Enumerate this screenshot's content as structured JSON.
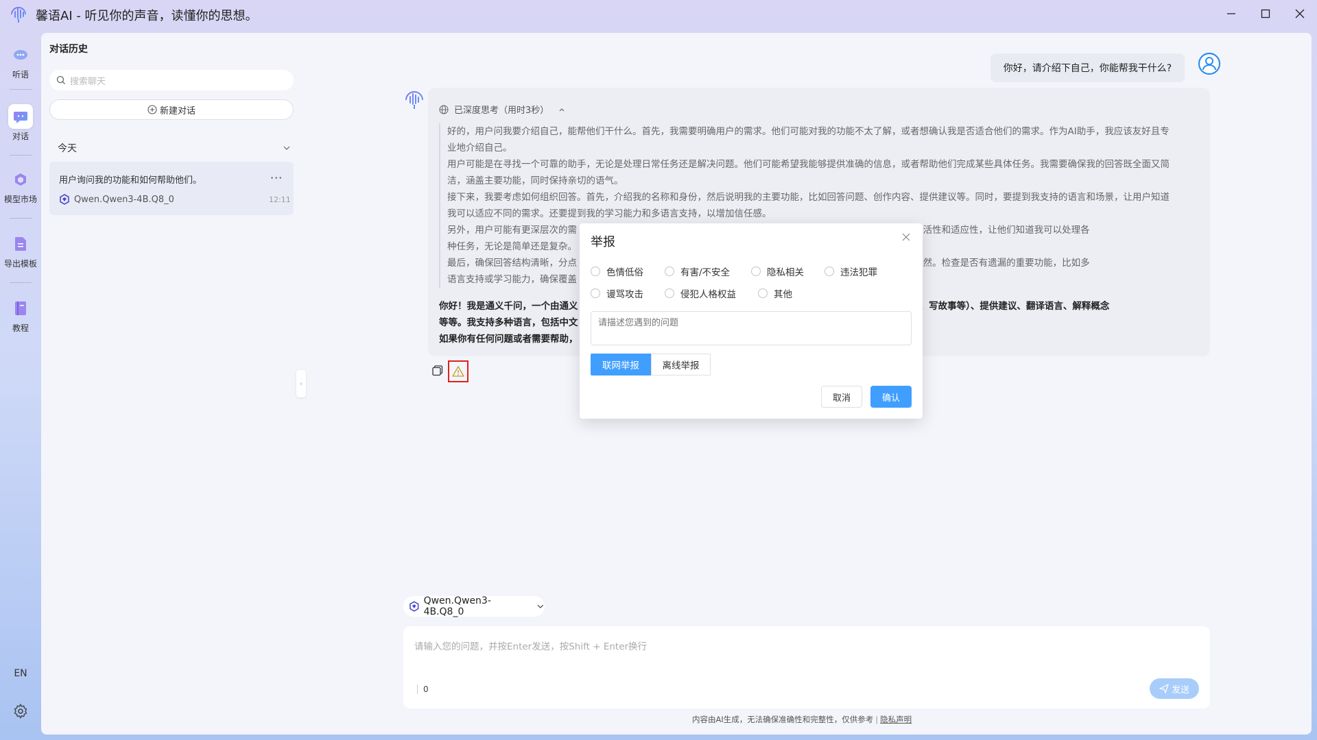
{
  "app": {
    "title": "馨语AI - 听见你的声音，读懂你的思想。",
    "logo_icon": "audio-wave-logo"
  },
  "window_controls": [
    "minimize-icon",
    "maximize-icon",
    "close-icon"
  ],
  "rail": {
    "items": [
      {
        "label": "听语",
        "icon": "listen-icon"
      },
      {
        "label": "对话",
        "icon": "chat-icon",
        "active": true
      },
      {
        "label": "模型市场",
        "icon": "model-market-icon"
      },
      {
        "label": "导出模板",
        "icon": "export-template-icon"
      },
      {
        "label": "教程",
        "icon": "tutorial-icon"
      }
    ],
    "lang": "EN",
    "settings_icon": "gear-icon"
  },
  "history": {
    "title": "对话历史",
    "search_placeholder": "搜索聊天",
    "new_chat_label": "新建对话",
    "group_label": "今天",
    "conversation": {
      "title": "用户询问我的功能和如何帮助他们。",
      "more": "···",
      "model": "Qwen.Qwen3-4B.Q8_0",
      "time": "12:11"
    }
  },
  "chat": {
    "user_message": "你好，请介绍下自己，你能帮我干什么?",
    "thinking_header": "已深度思考（用时3秒）",
    "thinking_lines": [
      "好的，用户问我要介绍自己，能帮他们干什么。首先，我需要明确用户的需求。他们可能对我的功能不太了解，或者想确认我是否适合他们的需求。作为AI助手，我应该友好且专",
      "业地介绍自己。",
      "用户可能是在寻找一个可靠的助手，无论是处理日常任务还是解决问题。他们可能希望我能够提供准确的信息，或者帮助他们完成某些具体任务。我需要确保我的回答既全面又简",
      "洁，涵盖主要功能，同时保持亲切的语气。",
      "接下来，我要考虑如何组织回答。首先，介绍我的名称和身份，然后说明我的主要功能，比如回答问题、创作内容、提供建议等。同时，要提到我支持的语言和场景，让用户知道",
      "我可以适应不同的需求。还要提到我的学习能力和多语言支持，以增加信任感。",
      "另外，用户可能有更深层次的需                                                                                   要在回答中体现出我的灵活性和适应性，让他们知道我可以处理各",
      "种任务，无论是简单还是复杂。",
      "最后，确保回答结构清晰，分点                                                                                   的术语，让回答更亲切自然。检查是否有遗漏的重要功能，比如多",
      "语言支持或学习能力，确保覆盖"
    ],
    "answer_lines": [
      "你好！我是通义千问，一个由通义                                                                                   （如写文章、写诗、写故事等）、提供建议、翻译语言、解释概念",
      "等等。我支持多种语言，包括中文                                                                                   更精准的帮助。",
      "如果你有任何问题或者需要帮助，"
    ],
    "copy_icon": "copy-icon",
    "report_icon": "warning-icon"
  },
  "report_dialog": {
    "title": "举报",
    "options": [
      "色情低俗",
      "有害/不安全",
      "隐私相关",
      "违法犯罪",
      "谩骂攻击",
      "侵犯人格权益",
      "其他"
    ],
    "description_placeholder": "请描述您遇到的问题",
    "online_label": "联网举报",
    "offline_label": "离线举报",
    "cancel_label": "取消",
    "confirm_label": "确认"
  },
  "composer": {
    "model": "Qwen.Qwen3-4B.Q8_0",
    "placeholder": "请输入您的问题，并按Enter发送，按Shift + Enter换行",
    "char_count": "0",
    "send_label": "发送"
  },
  "footer": {
    "note": "内容由AI生成，无法确保准确性和完整性，仅供参考",
    "privacy": "隐私声明"
  },
  "colors": {
    "accent": "#409eff",
    "report_highlight": "#e0201b",
    "send_disabled": "#a8cdfa"
  }
}
